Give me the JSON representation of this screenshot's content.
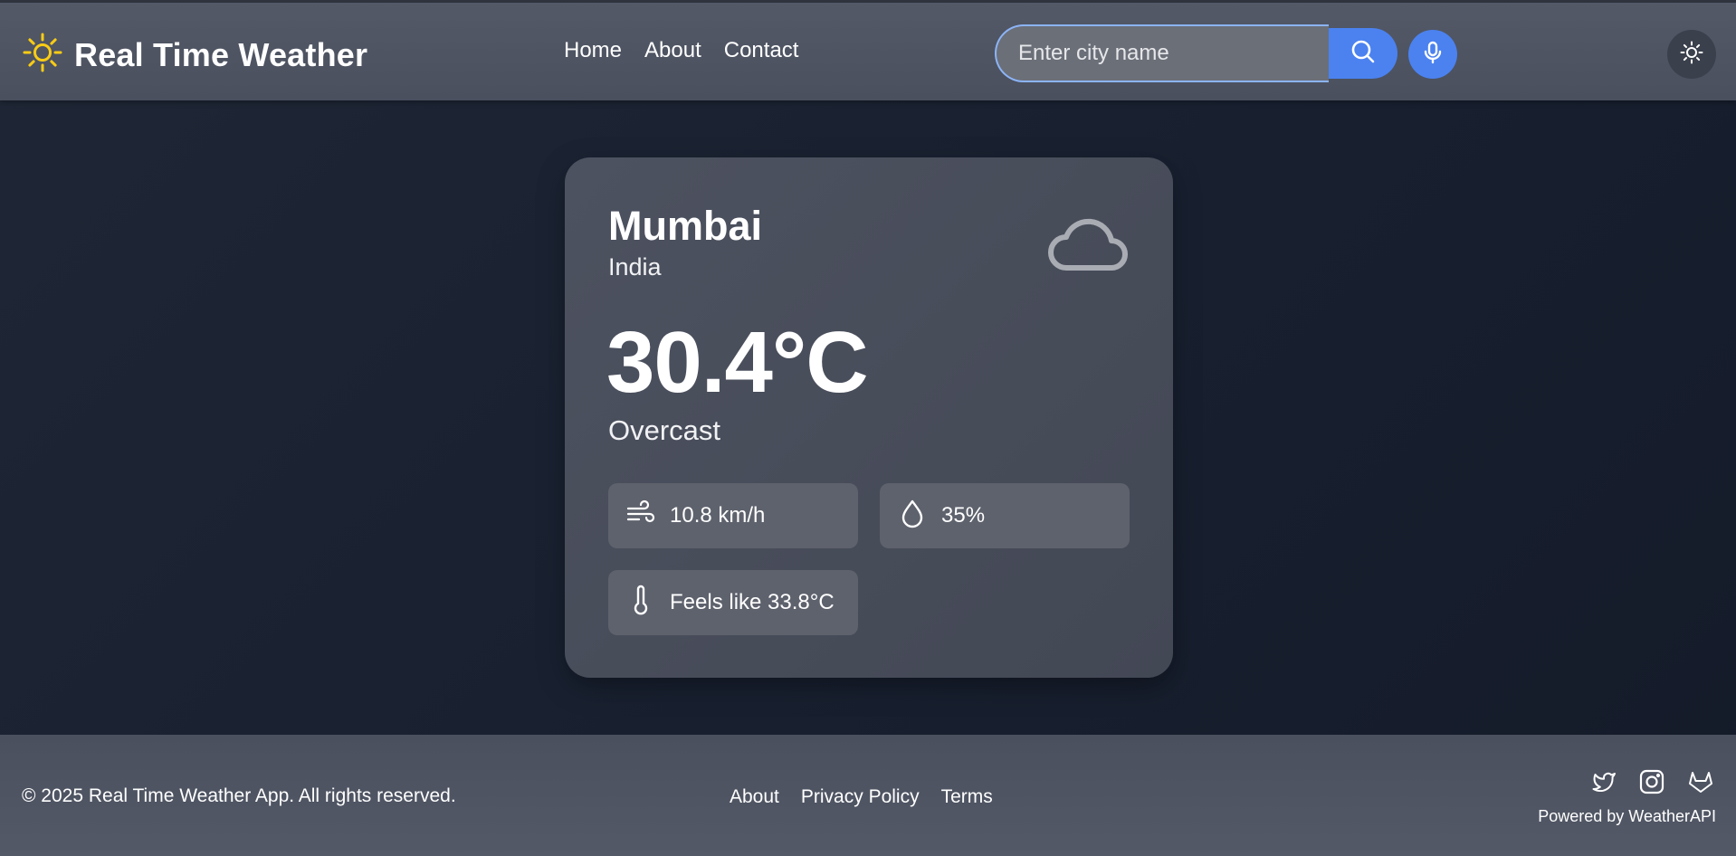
{
  "header": {
    "app_title": "Real Time Weather",
    "logo_icon": "sun-icon",
    "logo_color": "#facc15",
    "nav": [
      {
        "label": "Home"
      },
      {
        "label": "About"
      },
      {
        "label": "Contact"
      }
    ],
    "search": {
      "value": "",
      "placeholder": "Enter city name",
      "button_icon": "search-icon"
    },
    "mic_icon": "microphone-icon",
    "theme_icon": "sun-icon",
    "accent_color": "#4b82f0"
  },
  "weather": {
    "city": "Mumbai",
    "country": "India",
    "condition_icon": "cloud-icon",
    "temperature": "30.4°C",
    "condition": "Overcast",
    "wind": {
      "icon": "wind-icon",
      "value": "10.8 km/h"
    },
    "humidity": {
      "icon": "droplet-icon",
      "value": "35%"
    },
    "feels_like": {
      "icon": "thermometer-icon",
      "value": "Feels like 33.8°C"
    }
  },
  "footer": {
    "copyright": "© 2025 Real Time Weather App. All rights reserved.",
    "links": [
      {
        "label": "About"
      },
      {
        "label": "Privacy Policy"
      },
      {
        "label": "Terms"
      }
    ],
    "socials": [
      "twitter-icon",
      "instagram-icon",
      "gitlab-icon"
    ],
    "powered_by": "Powered by WeatherAPI"
  }
}
